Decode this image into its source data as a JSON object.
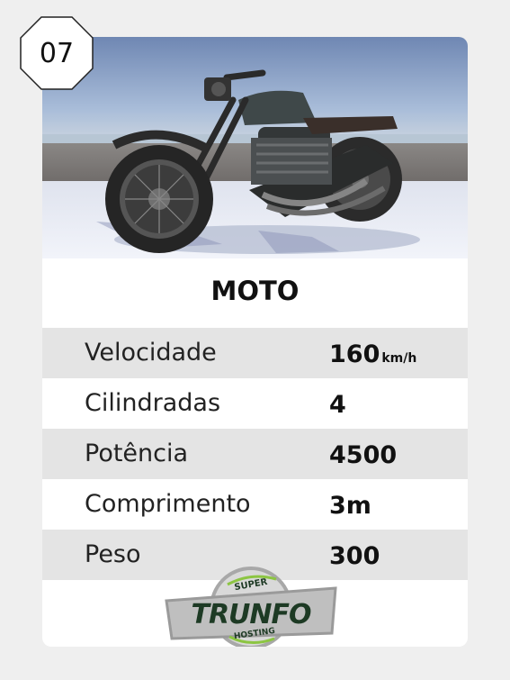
{
  "card": {
    "number": "07",
    "title": "MOTO",
    "image_subject": "motorcycle",
    "stats": [
      {
        "label": "Velocidade",
        "value": "160",
        "unit": "km/h"
      },
      {
        "label": "Cilindradas",
        "value": "4",
        "unit": ""
      },
      {
        "label": "Potência",
        "value": "4500",
        "unit": ""
      },
      {
        "label": "Comprimento",
        "value": "3m",
        "unit": ""
      },
      {
        "label": "Peso",
        "value": "300",
        "unit": ""
      }
    ]
  },
  "logo": {
    "top_text": "SUPER",
    "main_text": "TRUNFO",
    "bottom_text": "HOSTING"
  },
  "colors": {
    "background": "#efefef",
    "card": "#ffffff",
    "row_shade": "#e4e4e4",
    "logo_green": "#1d3a24"
  }
}
